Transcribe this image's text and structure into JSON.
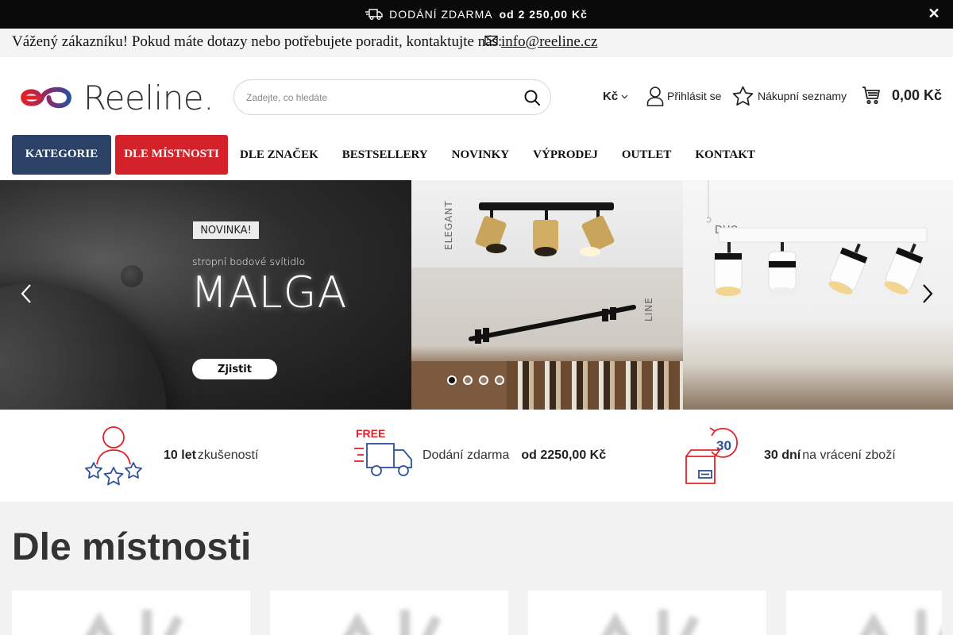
{
  "topbar": {
    "shipping_label": "DODÁNÍ ZDARMA",
    "shipping_value": "od 2 250,00 Kč",
    "close_symbol": "✕"
  },
  "contactbar": {
    "text": "Vážený zákazníku! Pokud máte dotazy nebo potřebujete poradit, kontaktujte nás:",
    "email": "info@reeline.cz"
  },
  "header": {
    "logo_text": "Reeline.",
    "search_placeholder": "Zadejte, co hledáte",
    "currency": "Kč",
    "login_label": "Přihlásit se",
    "lists_label": "Nákupní seznamy",
    "cart_total": "0,00 Kč"
  },
  "nav": {
    "items": [
      "KATEGORIE",
      "DLE MÍSTNOSTI",
      "DLE ZNAČEK",
      "BESTSELLERY",
      "NOVINKY",
      "VÝPRODEJ",
      "OUTLET",
      "KONTAKT"
    ]
  },
  "hero": {
    "badge": "NOVINKA!",
    "subtitle": "stropní bodové svítidlo",
    "title": "MALGA",
    "cta": "Zjistit",
    "label_elegant": "ELEGANT",
    "label_line": "LINE",
    "label_duo": "DUO",
    "slides_count": 4,
    "active_slide": 1
  },
  "benefits": [
    {
      "bold": "10 let",
      "text": "zkušeností",
      "icon": "people-stars-icon"
    },
    {
      "text": "Dodání zdarma",
      "bold": "od 2250,00 Kč",
      "icon": "free-delivery-truck-icon",
      "icon_text": "FREE"
    },
    {
      "bold": "30 dní",
      "text": "na vrácení zboží",
      "icon": "return-box-icon",
      "icon_text": "30"
    }
  ],
  "rooms": {
    "title": "Dle místnosti"
  },
  "colors": {
    "navy": "#2b4165",
    "red": "#d3222a",
    "logo_red": "#e2232a",
    "logo_blue": "#2d4f9e"
  }
}
